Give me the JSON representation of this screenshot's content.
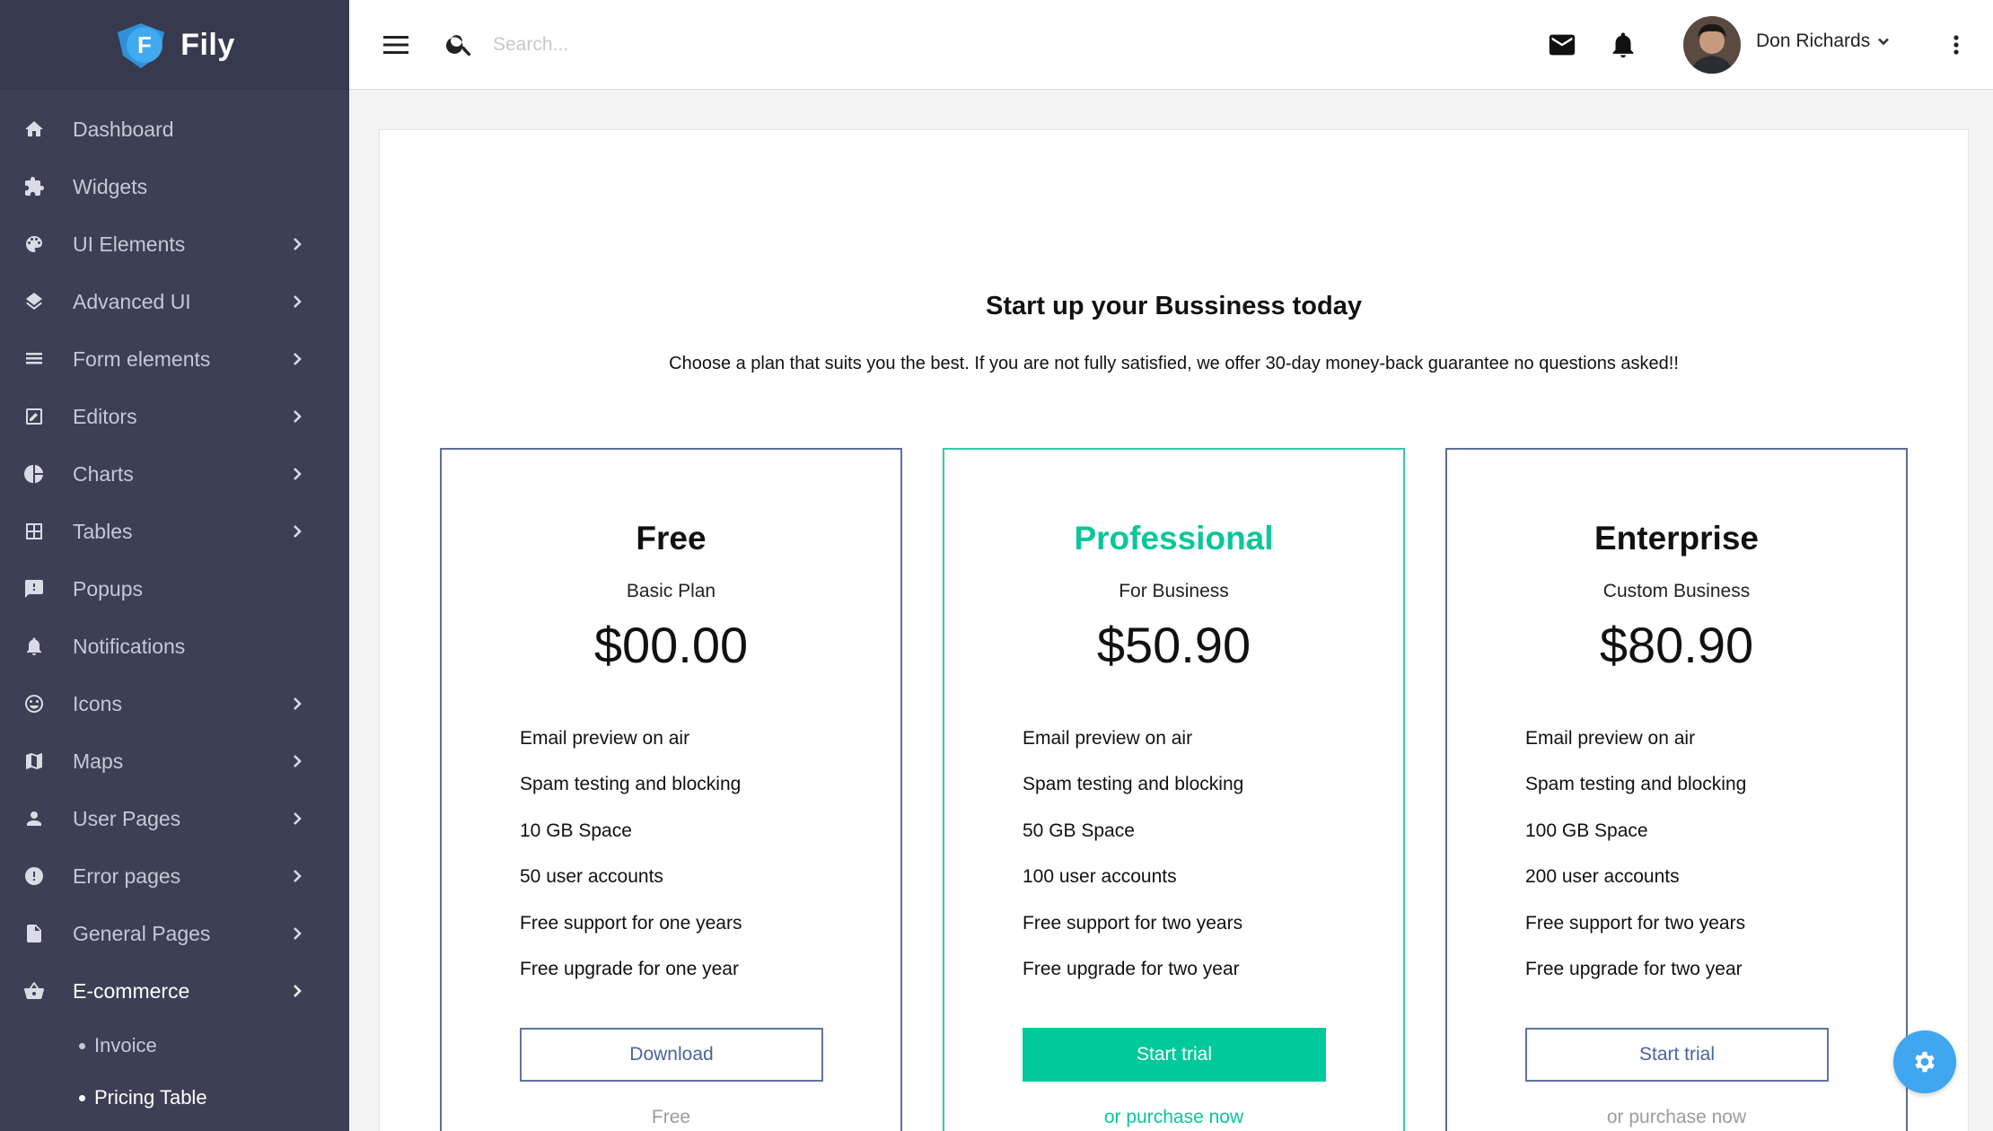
{
  "brand": {
    "name": "Fily",
    "letter": "F"
  },
  "topbar": {
    "search_placeholder": "Search...",
    "user_name": "Don Richards"
  },
  "sidebar": {
    "items": [
      {
        "label": "Dashboard",
        "icon": "home-icon"
      },
      {
        "label": "Widgets",
        "icon": "puzzle-icon"
      },
      {
        "label": "UI Elements",
        "icon": "palette-icon"
      },
      {
        "label": "Advanced UI",
        "icon": "layers-icon"
      },
      {
        "label": "Form elements",
        "icon": "list-icon"
      },
      {
        "label": "Editors",
        "icon": "edit-box-icon"
      },
      {
        "label": "Charts",
        "icon": "pie-chart-icon"
      },
      {
        "label": "Tables",
        "icon": "grid-icon"
      },
      {
        "label": "Popups",
        "icon": "alert-box-icon"
      },
      {
        "label": "Notifications",
        "icon": "bell-icon"
      },
      {
        "label": "Icons",
        "icon": "smiley-icon"
      },
      {
        "label": "Maps",
        "icon": "map-icon"
      },
      {
        "label": "User Pages",
        "icon": "person-icon"
      },
      {
        "label": "Error pages",
        "icon": "error-icon"
      },
      {
        "label": "General Pages",
        "icon": "file-icon"
      },
      {
        "label": "E-commerce",
        "icon": "basket-icon"
      }
    ],
    "subitems": [
      {
        "label": "Invoice"
      },
      {
        "label": "Pricing Table"
      }
    ]
  },
  "page": {
    "title": "Start up your Bussiness today",
    "subtitle": "Choose a plan that suits you the best. If you are not fully satisfied, we offer 30-day money-back guarantee no questions asked!!"
  },
  "plans": [
    {
      "name": "Free",
      "desc": "Basic Plan",
      "price": "$00.00",
      "features": [
        "Email preview on air",
        "Spam testing and blocking",
        "10 GB Space",
        "50 user accounts",
        "Free support for one years",
        "Free upgrade for one year"
      ],
      "button": "Download",
      "note": "Free"
    },
    {
      "name": "Professional",
      "desc": "For Business",
      "price": "$50.90",
      "features": [
        "Email preview on air",
        "Spam testing and blocking",
        "50 GB Space",
        "100 user accounts",
        "Free support for two years",
        "Free upgrade for two year"
      ],
      "button": "Start trial",
      "note": "or purchase now"
    },
    {
      "name": "Enterprise",
      "desc": "Custom Business",
      "price": "$80.90",
      "features": [
        "Email preview on air",
        "Spam testing and blocking",
        "100 GB Space",
        "200 user accounts",
        "Free support for two years",
        "Free upgrade for two year"
      ],
      "button": "Start trial",
      "note": "or purchase now"
    }
  ],
  "colors": {
    "sidebar_bg": "#3d3f55",
    "accent_green": "#02c99b",
    "accent_blue": "#3fa6ef",
    "outline_blue": "#5f74a2"
  }
}
